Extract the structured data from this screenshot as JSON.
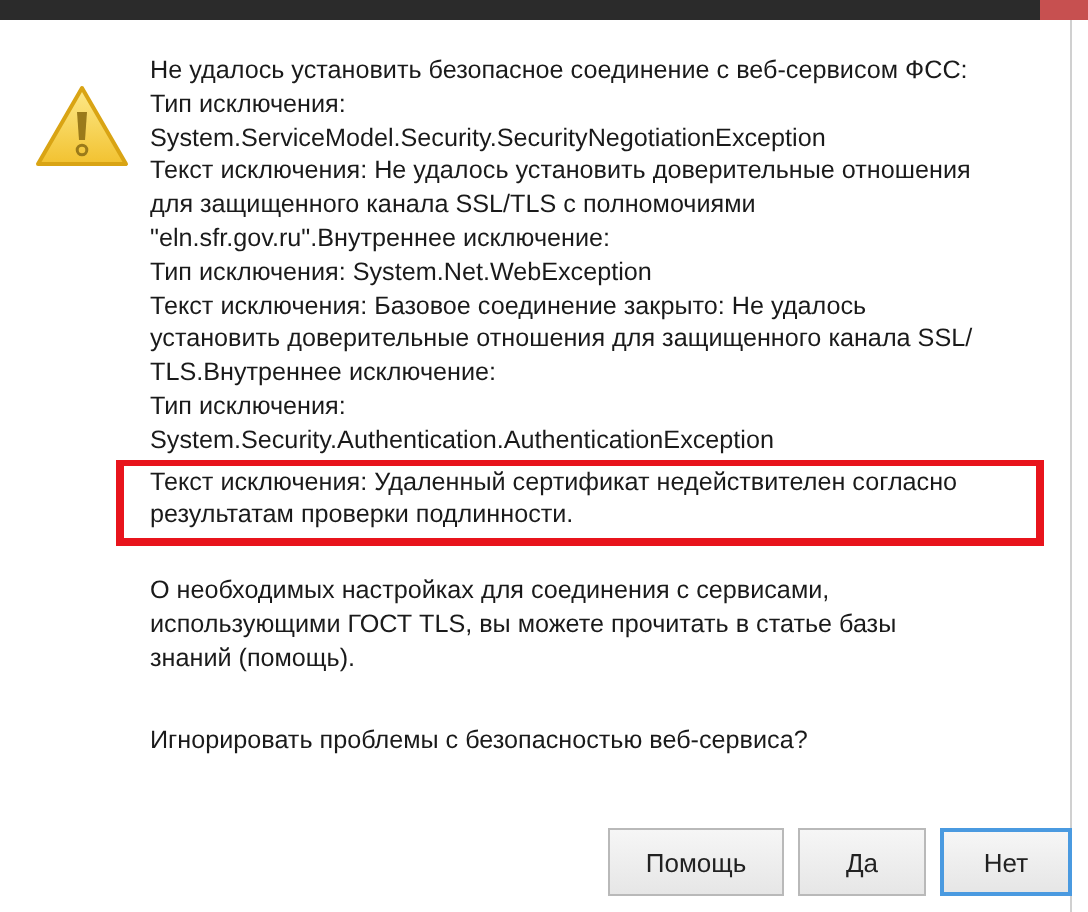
{
  "dialog": {
    "message_lines": [
      "Не удалось установить безопасное соединение с веб-сервисом ФСС:",
      "Тип исключения:",
      "System.ServiceModel.Security.SecurityNegotiationException",
      "Текст исключения: Не удалось установить доверительные отношения",
      "для защищенного канала SSL/TLS с полномочиями",
      "\"eln.sfr.gov.ru\".Внутреннее исключение:",
      "Тип исключения: System.Net.WebException",
      "Текст исключения: Базовое соединение закрыто: Не удалось",
      "установить доверительные отношения для защищенного канала SSL/",
      "TLS.Внутреннее исключение:",
      "Тип исключения:",
      "System.Security.Authentication.AuthenticationException"
    ],
    "highlighted_lines": [
      "Текст исключения: Удаленный сертификат недействителен согласно",
      "результатам проверки подлинности."
    ],
    "info_lines": [
      "О необходимых настройках для соединения с сервисами,",
      "использующими ГОСТ TLS, вы можете прочитать в статье базы",
      "знаний (помощь)."
    ],
    "question": "Игнорировать проблемы с безопасностью веб-сервиса?",
    "buttons": [
      {
        "label": "Помощь",
        "selected": false
      },
      {
        "label": "Да",
        "selected": false
      },
      {
        "label": "Нет",
        "selected": true
      }
    ]
  }
}
